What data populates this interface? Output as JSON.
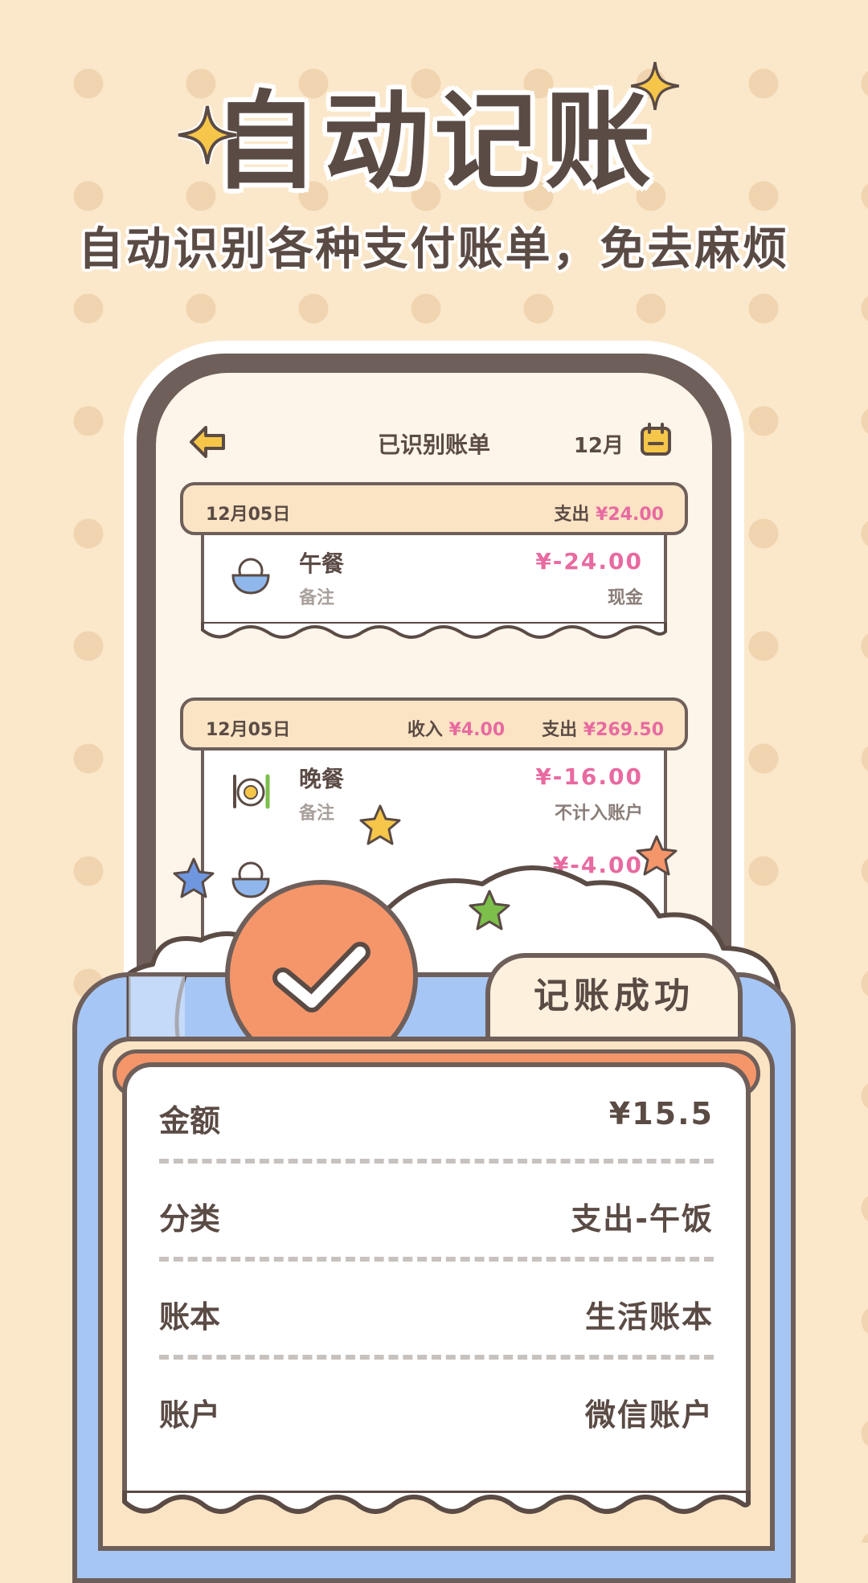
{
  "hero": {
    "title": "自动记账",
    "subtitle": "自动识别各种支付账单，免去麻烦"
  },
  "screen": {
    "title": "已识别账单",
    "month": "12月",
    "groups": [
      {
        "date": "12月05日",
        "expense_label": "支出",
        "expense_value": "¥24.00",
        "entries": [
          {
            "name": "午餐",
            "note": "备注",
            "amount": "¥-24.00",
            "account": "现金",
            "icon": "rice-bowl-icon"
          }
        ]
      },
      {
        "date": "12月05日",
        "income_label": "收入",
        "income_value": "¥4.00",
        "expense_label": "支出",
        "expense_value": "¥269.50",
        "entries": [
          {
            "name": "晚餐",
            "note": "备注",
            "amount": "¥-16.00",
            "account": "不计入账户",
            "icon": "dinner-plate-icon"
          },
          {
            "name": "",
            "note": "",
            "amount": "¥-4.00",
            "account": "",
            "icon": "rice-bowl-icon"
          }
        ]
      }
    ]
  },
  "success": {
    "tab_label": "记账成功",
    "rows": [
      {
        "label": "金额",
        "value": "¥15.5"
      },
      {
        "label": "分类",
        "value": "支出-午饭"
      },
      {
        "label": "账本",
        "value": "生活账本"
      },
      {
        "label": "账户",
        "value": "微信账户"
      }
    ]
  },
  "colors": {
    "background": "#fbe8cb",
    "ink": "#5b4b45",
    "pink": "#e86aa0",
    "orange": "#f5966a",
    "blue": "#a6c6f5",
    "star_yellow": "#f6c64a"
  }
}
